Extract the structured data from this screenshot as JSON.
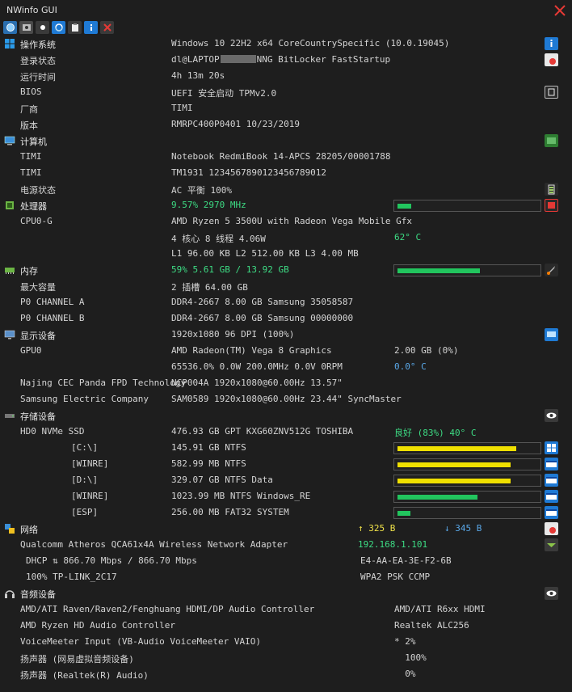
{
  "window": {
    "title": "NWinfo GUI"
  },
  "toolbar": {
    "buttons": [
      "refresh-icon",
      "screenshot-icon",
      "record-icon",
      "reload-icon",
      "clipboard-icon",
      "info-icon",
      "close-icon"
    ]
  },
  "os": {
    "label": "操作系统",
    "value": "Windows 10 22H2 x64 CoreCountrySpecific (10.0.19045)",
    "login_label": "登录状态",
    "login_value": "dl@LAPTOP",
    "login_value2": "NNG BitLocker FastStartup",
    "uptime_label": "运行时间",
    "uptime_value": "4h 13m 20s",
    "bios_label": "BIOS",
    "bios_value": "UEFI 安全启动 TPMv2.0",
    "vendor_label": "厂商",
    "vendor_value": "TIMI",
    "version_label": "版本",
    "version_value": "RMRPC400P0401 10/23/2019"
  },
  "computer": {
    "label": "计算机",
    "row1_label": "TIMI",
    "row1_value": "Notebook RedmiBook 14-APCS 28205/00001788",
    "row2_label": "TIMI",
    "row2_value": "TM1931 1234567890123456789012",
    "power_label": "电源状态",
    "power_value": "AC  平衡 100%"
  },
  "cpu": {
    "label": "处理器",
    "usage": "9.57% 2970 MHz",
    "usage_pct": 9.57,
    "name_label": "CPU0-G",
    "name_value": "AMD Ryzen 5 3500U with Radeon Vega Mobile Gfx",
    "cores": "4 核心 8 线程 4.06W",
    "temp": "62° C",
    "cache": "L1 96.00 KB L2 512.00 KB L3 4.00 MB"
  },
  "memory": {
    "label": "内存",
    "usage": "59% 5.61 GB / 13.92 GB",
    "usage_pct": 59,
    "max_label": "最大容量",
    "max_value": "2 插槽 64.00 GB",
    "ch_a_label": "P0 CHANNEL A",
    "ch_a_value": "DDR4-2667 8.00 GB Samsung 35058587",
    "ch_b_label": "P0 CHANNEL B",
    "ch_b_value": "DDR4-2667 8.00 GB Samsung 00000000"
  },
  "display": {
    "label": "显示设备",
    "value": "1920x1080 96 DPI (100%)",
    "gpu_label": "GPU0",
    "gpu_value": "AMD Radeon(TM) Vega 8 Graphics",
    "gpu_mem": "2.00 GB (0%)",
    "gpu_stats": "65536.0% 0.0W 200.0MHz 0.0V 0RPM",
    "gpu_temp": "0.0° C",
    "mon1_label": "Najing CEC Panda FPD Technology",
    "mon1_value": "NCP004A 1920x1080@60.00Hz 13.57\"",
    "mon2_label": "Samsung Electric Company",
    "mon2_value": "SAM0589 1920x1080@60.00Hz 23.44\" SyncMaster"
  },
  "storage": {
    "label": "存储设备",
    "disk_label": "HD0 NVMe SSD",
    "disk_value": "476.93 GB GPT KXG60ZNV512G TOSHIBA",
    "disk_health": "良好 (83%) 40° C",
    "volumes": [
      {
        "name": "[C:\\]",
        "info": "145.91 GB NTFS",
        "pct": 85,
        "color": "#f0e000"
      },
      {
        "name": "[WINRE]",
        "info": "582.99 MB NTFS",
        "pct": 81,
        "color": "#f0e000"
      },
      {
        "name": "[D:\\]",
        "info": "329.07 GB NTFS Data",
        "pct": 81,
        "color": "#f0e000"
      },
      {
        "name": "[WINRE]",
        "info": "1023.99 MB NTFS Windows_RE",
        "pct": 57,
        "color": "#22c55e"
      },
      {
        "name": "[ESP]",
        "info": "256.00 MB FAT32 SYSTEM",
        "pct": 9,
        "color": "#22c55e"
      }
    ]
  },
  "network": {
    "label": "网络",
    "up": "↑ 325 B",
    "down": "↓ 345 B",
    "adapter_label": "Qualcomm Atheros QCA61x4A Wireless Network Adapter",
    "ip": "192.168.1.101",
    "dhcp_label": "DHCP  ⇅  866.70 Mbps / 866.70 Mbps",
    "mac": "E4-AA-EA-3E-F2-6B",
    "ssid_label": "100% TP-LINK_2C17",
    "security": "WPA2 PSK CCMP"
  },
  "audio": {
    "label": "音频设备",
    "rows": [
      {
        "name": "AMD/ATI Raven/Raven2/Fenghuang HDMI/DP Audio Controller",
        "value": "AMD/ATI R6xx HDMI"
      },
      {
        "name": "AMD Ryzen HD Audio Controller",
        "value": "Realtek ALC256"
      },
      {
        "name": "VoiceMeeter Input (VB-Audio VoiceMeeter VAIO)",
        "value": "* 2%"
      },
      {
        "name": "扬声器 (网易虚拟音频设备)",
        "value": "  100%"
      },
      {
        "name": "扬声器 (Realtek(R) Audio)",
        "value": "  0%"
      }
    ]
  },
  "colors": {
    "accent_green": "#3ddc84",
    "accent_cyan": "#5aa8e8",
    "accent_yellow": "#f0e24a",
    "bg": "#1e1e1e"
  }
}
